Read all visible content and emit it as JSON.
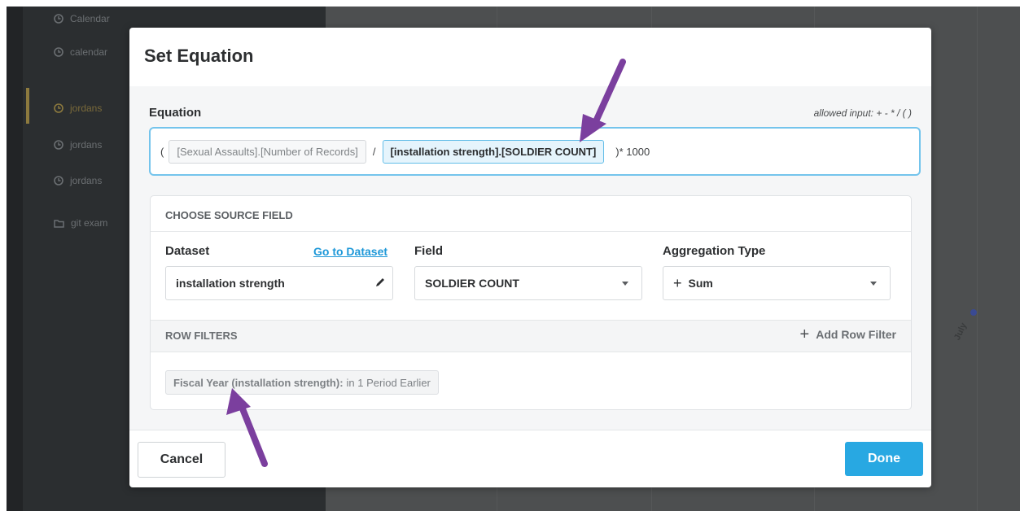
{
  "sidebar": {
    "items": [
      {
        "label": "Calendar",
        "icon": "clock-icon"
      },
      {
        "label": "calendar",
        "icon": "clock-icon"
      },
      {
        "label": "jordans",
        "icon": "clock-icon",
        "active": true
      },
      {
        "label": "jordans",
        "icon": "clock-icon"
      },
      {
        "label": "jordans",
        "icon": "clock-icon"
      },
      {
        "label": "git exam",
        "icon": "folder-icon"
      }
    ]
  },
  "background_chart": {
    "x_tick": "July"
  },
  "modal": {
    "title": "Set Equation",
    "equation_label": "Equation",
    "allowed_input": "allowed input: + - * / ( )",
    "equation": {
      "open_paren": "(",
      "term1": "[Sexual Assaults].[Number of Records]",
      "operator": "/",
      "term2": "[installation strength].[SOLDIER COUNT]",
      "tail": ")* 1000"
    },
    "source": {
      "heading": "CHOOSE SOURCE FIELD",
      "dataset_label": "Dataset",
      "go_to_dataset": "Go to Dataset",
      "dataset_value": "installation strength",
      "field_label": "Field",
      "field_value": "SOLDIER COUNT",
      "aggregation_label": "Aggregation Type",
      "aggregation_value": "Sum",
      "aggregation_icon": "+"
    },
    "row_filters": {
      "heading": "ROW FILTERS",
      "add_label": "Add Row Filter",
      "filter_name": "Fiscal Year (installation strength):",
      "filter_value": "in 1 Period Earlier"
    },
    "footer": {
      "cancel": "Cancel",
      "done": "Done"
    }
  },
  "colors": {
    "accent": "#28a8e2",
    "annotation_arrow": "#7b3f9e",
    "sidebar_bg": "#2b2e30",
    "overlay_bg": "#4d4f50"
  }
}
